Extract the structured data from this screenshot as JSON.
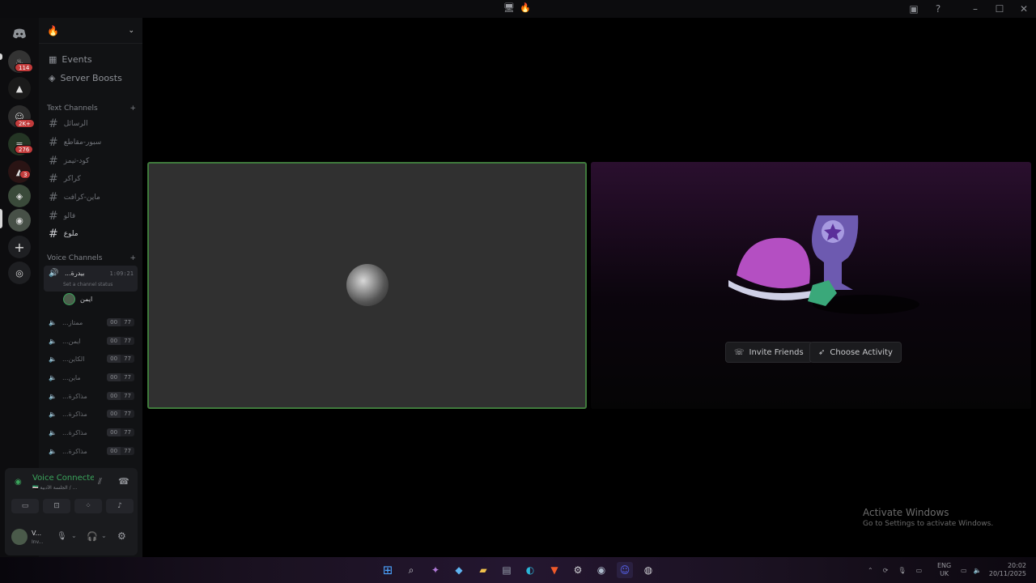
{
  "titlebar": {
    "server_emoji": "🔥"
  },
  "sidebar": {
    "server_header": "🔥",
    "nav": [
      {
        "label": "Events"
      },
      {
        "label": "Server Boosts"
      }
    ],
    "text_category": "Text Channels",
    "text_channels": [
      "الرسائل",
      "سبور-مقاطع",
      "كود-تيمز",
      "كراكر",
      "ماين-كرافت",
      "فالو",
      "ملوع"
    ],
    "voice_category": "Voice Channels",
    "active_voice": {
      "name": "...بيدرة",
      "timer": "1:09:21",
      "status_placeholder": "Set a channel status",
      "member": "ايمن"
    },
    "voice_channels": [
      {
        "name": "...ممتاز",
        "count": "00",
        "limit": "77"
      },
      {
        "name": "...ايمن",
        "count": "00",
        "limit": "77"
      },
      {
        "name": "...الكاين",
        "count": "00",
        "limit": "77"
      },
      {
        "name": "...ماين",
        "count": "00",
        "limit": "77"
      },
      {
        "name": "...مذاكرة",
        "count": "00",
        "limit": "77"
      },
      {
        "name": "...مذاكرة",
        "count": "00",
        "limit": "77"
      },
      {
        "name": "...مذاكرة",
        "count": "00",
        "limit": "77"
      },
      {
        "name": "...مذاكرة",
        "count": "00",
        "limit": "77"
      }
    ],
    "server_badges": [
      "114",
      "2K+",
      "276",
      "3"
    ]
  },
  "voice_panel": {
    "status": "Voice Connecte",
    "sub": "🇸🇾 الجلسة الأدبية / ...",
    "user_name": "V...",
    "user_status": "Inv..."
  },
  "stage": {
    "invite_label": "Invite Friends",
    "activity_label": "Choose Activity"
  },
  "watermark": {
    "title": "Activate Windows",
    "subtitle": "Go to Settings to activate Windows."
  },
  "tray": {
    "lang": "ENG",
    "region": "UK",
    "time": "20:02",
    "date": "20/11/2025"
  },
  "colors": {
    "speaking_border": "#3f7a3c",
    "voice_green": "#3ba55c",
    "badge_red": "#c23b3b"
  }
}
